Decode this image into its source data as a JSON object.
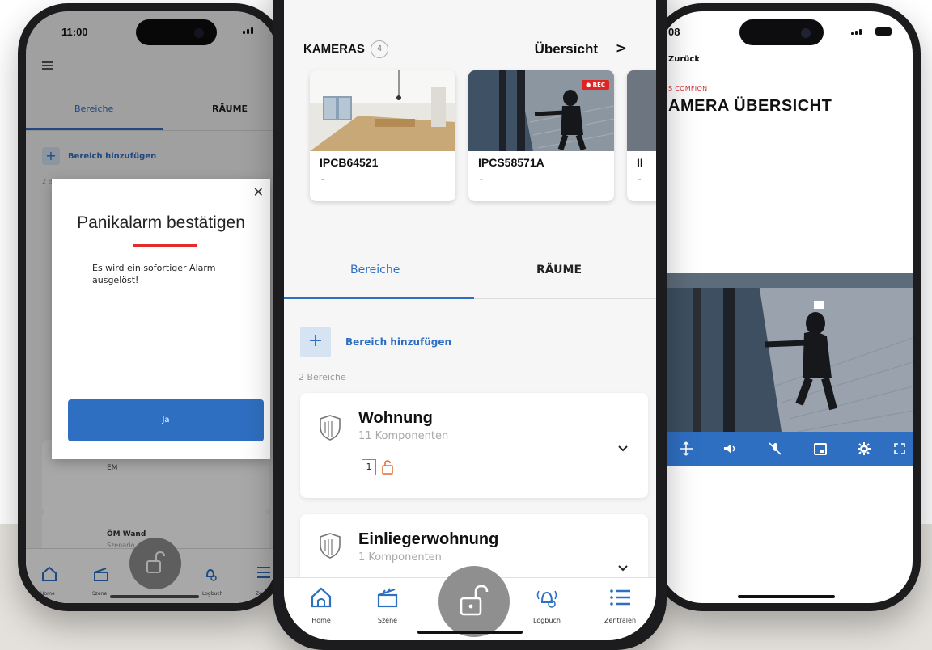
{
  "colors": {
    "accent": "#2f6fc2",
    "alert_red": "#e22b2b",
    "brand_red": "#d3282b",
    "background_bottom": "#e4e1dc"
  },
  "left_phone": {
    "status_time": "11:00",
    "tabs": [
      {
        "label": "Bereiche",
        "active": true
      },
      {
        "label": "RÄUME",
        "active": false
      }
    ],
    "add_area_label": "Bereich hinzufügen",
    "area_count_label": "2 B",
    "list_card_1_title": "EM",
    "list_card_2_title": "ÖM Wand",
    "list_card_2_sub": "Szenario",
    "nav": [
      "Home",
      "Szene",
      "Logbuch",
      "Zentr"
    ],
    "dialog": {
      "title": "Panikalarm bestätigen",
      "message": "Es wird ein sofortiger Alarm ausgelöst!",
      "confirm_label": "Ja",
      "close_icon": "close-icon"
    }
  },
  "center_phone": {
    "cameras": {
      "title": "KAMERAS",
      "count": "4",
      "overview_label": "Übersicht",
      "items": [
        {
          "name": "IPCB64521",
          "status": "-",
          "recording": false
        },
        {
          "name": "IPCS58571A",
          "status": "-",
          "recording": true,
          "rec_label": "● REC"
        },
        {
          "name": "II",
          "status": "-",
          "recording": false
        }
      ]
    },
    "tabs": [
      {
        "label": "Bereiche",
        "active": true
      },
      {
        "label": "RÄUME",
        "active": false
      }
    ],
    "add_area_label": "Bereich hinzufügen",
    "area_count_label": "2 Bereiche",
    "areas": [
      {
        "title": "Wohnung",
        "subtitle": "11 Komponenten",
        "badge": "1",
        "icon": "shield-icon"
      },
      {
        "title": "Einliegerwohnung",
        "subtitle": "1 Komponenten",
        "icon": "shield-icon"
      }
    ],
    "nav": [
      {
        "label": "Home",
        "icon": "home-icon"
      },
      {
        "label": "Szene",
        "icon": "clapperboard-icon"
      },
      {
        "label": "Logbuch",
        "icon": "alarm-bell-icon"
      },
      {
        "label": "Zentralen",
        "icon": "list-icon"
      }
    ],
    "center_button_icon": "unlock-icon"
  },
  "right_phone": {
    "status_time": "08",
    "back_label": "Zurück",
    "brand_label": "S COMFION",
    "title": "AMERA ÜBERSICHT",
    "video_controls": [
      "move-icon",
      "volume-icon",
      "mic-off-icon",
      "calendar-icon",
      "settings-icon",
      "fullscreen-icon"
    ]
  }
}
